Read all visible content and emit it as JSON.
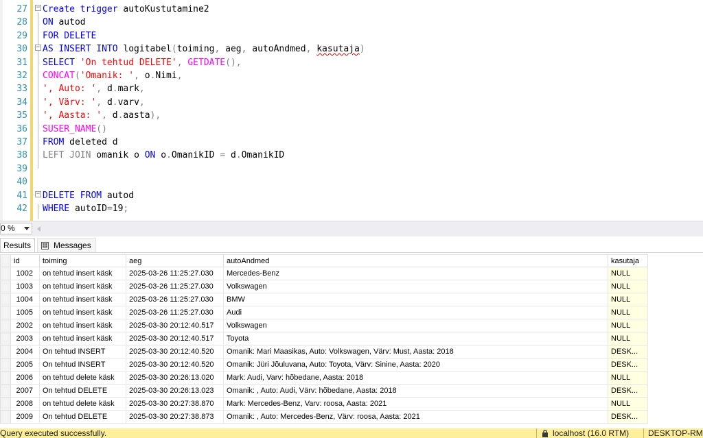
{
  "editor": {
    "lines": [
      {
        "num": "27",
        "tokens": [
          {
            "t": "Create trigger ",
            "c": "kw"
          },
          {
            "t": "autoKustutamine2",
            "c": "id"
          }
        ]
      },
      {
        "num": "28",
        "tokens": [
          {
            "t": "ON ",
            "c": "kw"
          },
          {
            "t": "autod",
            "c": "id"
          }
        ]
      },
      {
        "num": "29",
        "tokens": [
          {
            "t": "FOR DELETE",
            "c": "kw"
          }
        ]
      },
      {
        "num": "30",
        "tokens": [
          {
            "t": "AS INSERT INTO ",
            "c": "kw"
          },
          {
            "t": "logitabel",
            "c": "id"
          },
          {
            "t": "(",
            "c": "gr"
          },
          {
            "t": "toiming",
            "c": "id"
          },
          {
            "t": ", ",
            "c": "gr"
          },
          {
            "t": "aeg",
            "c": "id"
          },
          {
            "t": ", ",
            "c": "gr"
          },
          {
            "t": "autoAndmed",
            "c": "id"
          },
          {
            "t": ", ",
            "c": "gr"
          },
          {
            "t": "kasutaja",
            "c": "id squiggle"
          },
          {
            "t": ")",
            "c": "gr"
          }
        ]
      },
      {
        "num": "31",
        "tokens": [
          {
            "t": "SELECT ",
            "c": "kw"
          },
          {
            "t": "'On tehtud DELETE'",
            "c": "str"
          },
          {
            "t": ", ",
            "c": "gr"
          },
          {
            "t": "GETDATE",
            "c": "fn"
          },
          {
            "t": "(),",
            "c": "gr"
          }
        ]
      },
      {
        "num": "32",
        "tokens": [
          {
            "t": "CONCAT",
            "c": "fn"
          },
          {
            "t": "(",
            "c": "gr"
          },
          {
            "t": "'Omanik: '",
            "c": "str"
          },
          {
            "t": ", ",
            "c": "gr"
          },
          {
            "t": "o",
            "c": "id"
          },
          {
            "t": ".",
            "c": "gr"
          },
          {
            "t": "Nimi",
            "c": "id"
          },
          {
            "t": ",",
            "c": "gr"
          }
        ]
      },
      {
        "num": "33",
        "tokens": [
          {
            "t": "', Auto: '",
            "c": "str"
          },
          {
            "t": ", ",
            "c": "gr"
          },
          {
            "t": "d",
            "c": "id"
          },
          {
            "t": ".",
            "c": "gr"
          },
          {
            "t": "mark",
            "c": "id"
          },
          {
            "t": ",",
            "c": "gr"
          }
        ]
      },
      {
        "num": "34",
        "tokens": [
          {
            "t": "', Värv: '",
            "c": "str"
          },
          {
            "t": ", ",
            "c": "gr"
          },
          {
            "t": "d",
            "c": "id"
          },
          {
            "t": ".",
            "c": "gr"
          },
          {
            "t": "varv",
            "c": "id"
          },
          {
            "t": ",",
            "c": "gr"
          }
        ]
      },
      {
        "num": "35",
        "tokens": [
          {
            "t": "', Aasta: '",
            "c": "str"
          },
          {
            "t": ", ",
            "c": "gr"
          },
          {
            "t": "d",
            "c": "id"
          },
          {
            "t": ".",
            "c": "gr"
          },
          {
            "t": "aasta",
            "c": "id"
          },
          {
            "t": "),",
            "c": "gr"
          }
        ]
      },
      {
        "num": "36",
        "tokens": [
          {
            "t": "SUSER_NAME",
            "c": "fn"
          },
          {
            "t": "()",
            "c": "gr"
          }
        ]
      },
      {
        "num": "37",
        "tokens": [
          {
            "t": "FROM ",
            "c": "kw"
          },
          {
            "t": "deleted ",
            "c": "id"
          },
          {
            "t": "d",
            "c": "id"
          }
        ]
      },
      {
        "num": "38",
        "tokens": [
          {
            "t": "LEFT JOIN ",
            "c": "gr"
          },
          {
            "t": "omanik ",
            "c": "id"
          },
          {
            "t": "o ",
            "c": "id"
          },
          {
            "t": "ON ",
            "c": "kw"
          },
          {
            "t": "o",
            "c": "id"
          },
          {
            "t": ".",
            "c": "gr"
          },
          {
            "t": "OmanikID ",
            "c": "id"
          },
          {
            "t": "= ",
            "c": "gr"
          },
          {
            "t": "d",
            "c": "id"
          },
          {
            "t": ".",
            "c": "gr"
          },
          {
            "t": "OmanikID",
            "c": "id"
          }
        ]
      },
      {
        "num": "39",
        "tokens": []
      },
      {
        "num": "40",
        "tokens": []
      },
      {
        "num": "41",
        "tokens": [
          {
            "t": "DELETE FROM ",
            "c": "kw"
          },
          {
            "t": "autod",
            "c": "id"
          }
        ]
      },
      {
        "num": "42",
        "tokens": [
          {
            "t": "WHERE ",
            "c": "kw"
          },
          {
            "t": "autoID",
            "c": "id"
          },
          {
            "t": "=",
            "c": "gr"
          },
          {
            "t": "19",
            "c": "id"
          },
          {
            "t": ";",
            "c": "gr"
          }
        ]
      }
    ]
  },
  "zoom": {
    "value": "0 %"
  },
  "tabs": {
    "results": "Results",
    "messages": "Messages"
  },
  "grid": {
    "columns": [
      "id",
      "toiming",
      "aeg",
      "autoAndmed",
      "kasutaja"
    ],
    "rows": [
      [
        "1002",
        "on tehtud insert käsk",
        "2025-03-26 11:25:27.030",
        "Mercedes-Benz",
        "NULL"
      ],
      [
        "1003",
        "on tehtud insert käsk",
        "2025-03-26 11:25:27.030",
        "Volkswagen",
        "NULL"
      ],
      [
        "1004",
        "on tehtud insert käsk",
        "2025-03-26 11:25:27.030",
        "BMW",
        "NULL"
      ],
      [
        "1005",
        "on tehtud insert käsk",
        "2025-03-26 11:25:27.030",
        "Audi",
        "NULL"
      ],
      [
        "2002",
        "on tehtud insert käsk",
        "2025-03-30 20:12:40.517",
        "Volkswagen",
        "NULL"
      ],
      [
        "2003",
        "on tehtud insert käsk",
        "2025-03-30 20:12:40.517",
        "Toyota",
        "NULL"
      ],
      [
        "2004",
        "On tehtud INSERT",
        "2025-03-30 20:12:40.520",
        "Omanik: Mari Maasikas, Auto: Volkswagen, Värv: Must, Aasta: 2018",
        "DESK..."
      ],
      [
        "2005",
        "On tehtud INSERT",
        "2025-03-30 20:12:40.520",
        "Omanik: Jüri Jõuluvana, Auto: Toyota, Värv: Sinine, Aasta: 2020",
        "DESK..."
      ],
      [
        "2006",
        "on tehtud delete käsk",
        "2025-03-30 20:26:13.020",
        "Mark: Audi, Varv: hõbedane, Aasta: 2018",
        "NULL"
      ],
      [
        "2007",
        "On tehtud DELETE",
        "2025-03-30 20:26:13.023",
        "Omanik: , Auto: Audi, Värv: hõbedane, Aasta: 2018",
        "DESK..."
      ],
      [
        "2008",
        "on tehtud delete käsk",
        "2025-03-30 20:27:38.870",
        "Mark: Mercedes-Benz, Varv: roosa, Aasta: 2021",
        "NULL"
      ],
      [
        "2009",
        "On tehtud DELETE",
        "2025-03-30 20:27:38.873",
        "Omanik: , Auto: Mercedes-Benz, Värv: roosa, Aasta: 2021",
        "DESK..."
      ]
    ]
  },
  "status": {
    "message": "Query executed successfully.",
    "server": "localhost (16.0 RTM)",
    "machine": "DESKTOP-RM"
  }
}
